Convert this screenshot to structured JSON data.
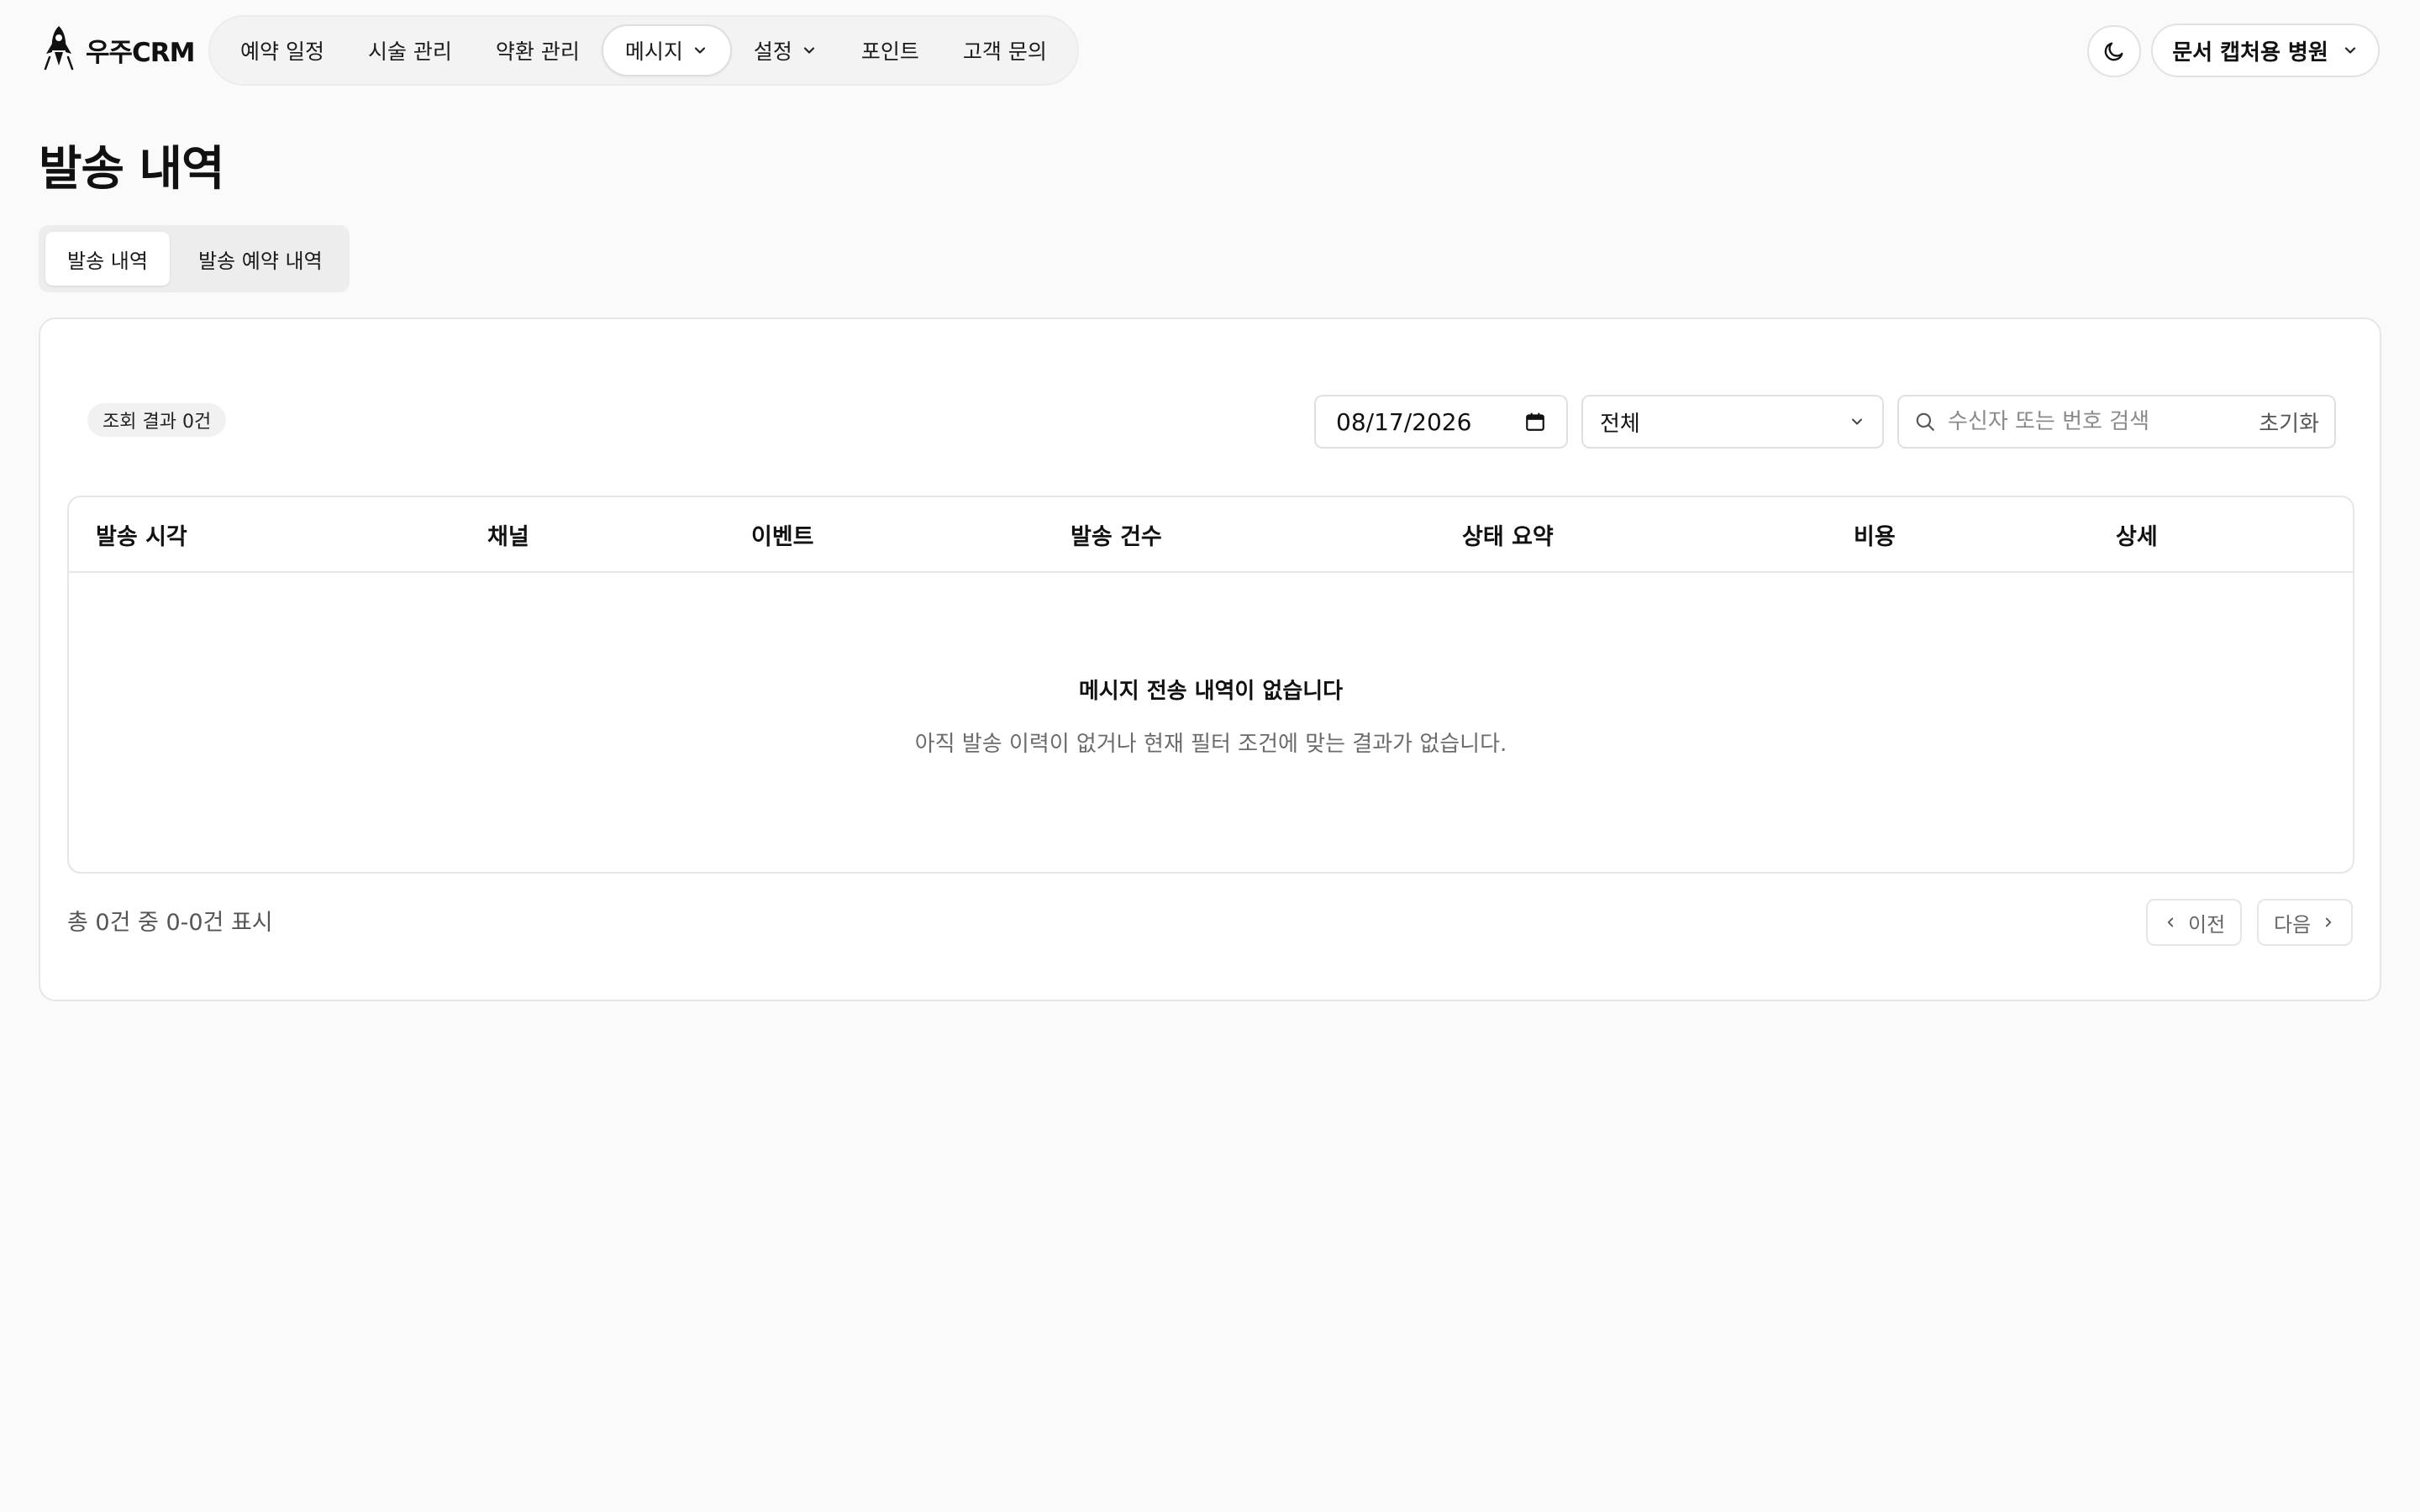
{
  "app": {
    "logo_text": "우주CRM",
    "logo_icon": "rocket-icon"
  },
  "nav": {
    "items": [
      {
        "label": "예약 일정"
      },
      {
        "label": "시술 관리"
      },
      {
        "label": "약환 관리"
      },
      {
        "label": "메시지",
        "dropdown": true,
        "active": true
      },
      {
        "label": "설정",
        "dropdown": true
      },
      {
        "label": "포인트"
      },
      {
        "label": "고객 문의"
      }
    ]
  },
  "header": {
    "theme_icon": "moon-icon",
    "account_label": "문서 캡처용 병원"
  },
  "page": {
    "title": "발송 내역"
  },
  "tabs": [
    {
      "label": "발송 내역",
      "active": true
    },
    {
      "label": "발송 예약 내역",
      "active": false
    }
  ],
  "filters": {
    "result_count": "조회 결과 0건",
    "date_value": "08/17/2026",
    "status_select": "전체",
    "search_placeholder": "수신자 또는 번호 검색",
    "search_value": "",
    "reset_label": "초기화"
  },
  "table": {
    "columns": [
      "발송 시각",
      "채널",
      "이벤트",
      "발송 건수",
      "상태 요약",
      "비용",
      "상세"
    ],
    "rows": [],
    "empty_title": "메시지 전송 내역이 없습니다",
    "empty_description": "아직 발송 이력이 없거나 현재 필터 조건에 맞는 결과가 없습니다."
  },
  "pagination": {
    "summary": "총 0건 중 0-0건 표시",
    "prev_label": "이전",
    "next_label": "다음"
  }
}
